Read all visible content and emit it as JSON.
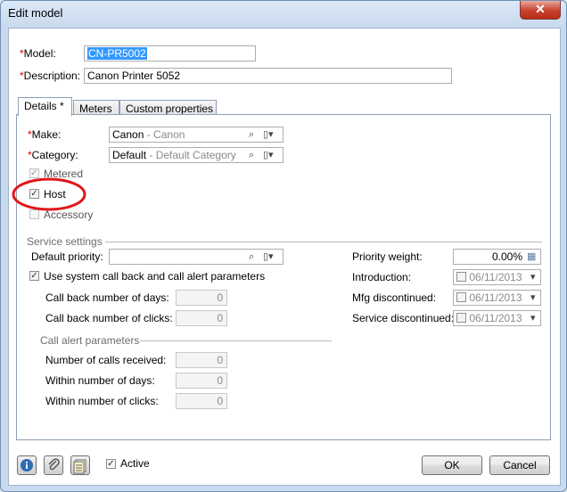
{
  "window": {
    "title": "Edit model",
    "close_glyph": "✕"
  },
  "model": {
    "label": "Model:",
    "value": "CN-PR5002"
  },
  "description": {
    "label": "Description:",
    "value": "Canon Printer 5052"
  },
  "required_marker": "*",
  "tabs": [
    {
      "label": "Details *",
      "active": true
    },
    {
      "label": "Meters",
      "active": false
    },
    {
      "label": "Custom properties",
      "active": false
    }
  ],
  "make": {
    "label": "Make:",
    "value": "Canon",
    "secondary": "- Canon"
  },
  "category": {
    "label": "Category:",
    "value": "Default",
    "secondary": "- Default Category"
  },
  "checkboxes": {
    "metered": {
      "label": "Metered",
      "checked": true
    },
    "host": {
      "label": "Host",
      "checked": true
    },
    "accessory": {
      "label": "Accessory",
      "checked": false
    }
  },
  "service": {
    "section_label": "Service settings",
    "default_priority_label": "Default priority:",
    "default_priority_value": "",
    "use_system_label": "Use system call back and call alert parameters",
    "use_system_checked": true,
    "call_back_days_label": "Call back number of days:",
    "call_back_days_value": "0",
    "call_back_clicks_label": "Call back number of clicks:",
    "call_back_clicks_value": "0",
    "priority_weight_label": "Priority weight:",
    "priority_weight_value": "0.00%",
    "introduction_label": "Introduction:",
    "introduction_value": "06/11/2013",
    "mfg_discontinued_label": "Mfg discontinued:",
    "mfg_discontinued_value": "06/11/2013",
    "service_discontinued_label": "Service discontinued:",
    "service_discontinued_value": "06/11/2013"
  },
  "call_alert": {
    "section_label": "Call alert parameters",
    "calls_received_label": "Number of calls received:",
    "calls_received_value": "0",
    "within_days_label": "Within number of days:",
    "within_days_value": "0",
    "within_clicks_label": "Within number of clicks:",
    "within_clicks_value": "0"
  },
  "footer": {
    "active_label": "Active",
    "active_checked": true,
    "ok_label": "OK",
    "cancel_label": "Cancel",
    "icons": [
      "info-icon",
      "attachment-icon",
      "notes-icon"
    ]
  },
  "colors": {
    "annotation_circle": "#e0161c",
    "selection": "#3399ff",
    "required": "#dd0000"
  }
}
